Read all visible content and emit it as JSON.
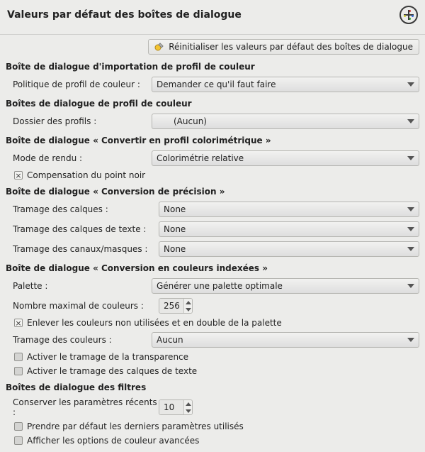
{
  "header": {
    "title": "Valeurs par défaut des boîtes de dialogue"
  },
  "reset": {
    "label": "Réinitialiser les valeurs par défaut des boîtes de dialogue"
  },
  "sections": {
    "colorImport": {
      "title": "Boîte de dialogue d'importation de profil de couleur",
      "policy_label": "Politique de profil de couleur :",
      "policy_value": "Demander ce qu'il faut faire"
    },
    "colorProfile": {
      "title": "Boîtes de dialogue de profil de couleur",
      "folder_label": "Dossier des profils :",
      "folder_value": "(Aucun)"
    },
    "convertProfile": {
      "title": "Boîte de dialogue « Convertir en profil colorimétrique »",
      "render_label": "Mode de rendu :",
      "render_value": "Colorimétrie relative",
      "bpc_label": "Compensation du point noir",
      "bpc_checked": true
    },
    "precision": {
      "title": "Boîte de dialogue « Conversion de précision »",
      "dither_layers_label": "Tramage des calques :",
      "dither_layers_value": "None",
      "dither_text_label": "Tramage des calques de texte :",
      "dither_text_value": "None",
      "dither_channels_label": "Tramage des canaux/masques :",
      "dither_channels_value": "None"
    },
    "indexed": {
      "title": "Boîte de dialogue « Conversion en couleurs indexées »",
      "palette_label": "Palette :",
      "palette_value": "Générer une palette optimale",
      "maxcolors_label": "Nombre maximal de couleurs :",
      "maxcolors_value": "256",
      "remove_dup_label": "Enlever les couleurs non utilisées et en double de la palette",
      "remove_dup_checked": true,
      "dither_label": "Tramage des couleurs :",
      "dither_value": "Aucun",
      "transp_dither_label": "Activer le tramage de la transparence",
      "transp_dither_checked": false,
      "text_dither_label": "Activer le tramage des calques de texte",
      "text_dither_checked": false
    },
    "filters": {
      "title": "Boîtes de dialogue des filtres",
      "keep_recent_label": "Conserver les paramètres récents :",
      "keep_recent_value": "10",
      "use_last_label": "Prendre par défaut les derniers paramètres utilisés",
      "use_last_checked": false,
      "show_color_label": "Afficher les options de couleur avancées",
      "show_color_checked": false
    }
  }
}
